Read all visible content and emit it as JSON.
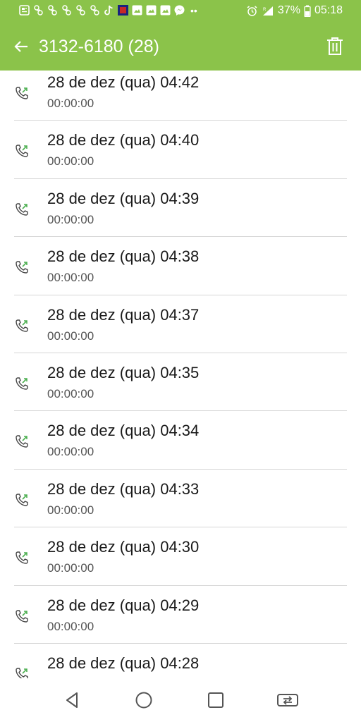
{
  "status_bar": {
    "battery": "37%",
    "time": "05:18",
    "overflow_dots": "••"
  },
  "app_bar": {
    "title": "3132-6180 (28)"
  },
  "calls": [
    {
      "date": "28 de dez (qua) 04:42",
      "duration": "00:00:00"
    },
    {
      "date": "28 de dez (qua) 04:40",
      "duration": "00:00:00"
    },
    {
      "date": "28 de dez (qua) 04:39",
      "duration": "00:00:00"
    },
    {
      "date": "28 de dez (qua) 04:38",
      "duration": "00:00:00"
    },
    {
      "date": "28 de dez (qua) 04:37",
      "duration": "00:00:00"
    },
    {
      "date": "28 de dez (qua) 04:35",
      "duration": "00:00:00"
    },
    {
      "date": "28 de dez (qua) 04:34",
      "duration": "00:00:00"
    },
    {
      "date": "28 de dez (qua) 04:33",
      "duration": "00:00:00"
    },
    {
      "date": "28 de dez (qua) 04:30",
      "duration": "00:00:00"
    },
    {
      "date": "28 de dez (qua) 04:29",
      "duration": "00:00:00"
    },
    {
      "date": "28 de dez (qua) 04:28",
      "duration": ""
    }
  ],
  "icons": {
    "call_type": "outgoing-call-icon",
    "back": "arrow-left-icon",
    "delete": "trash-icon"
  },
  "colors": {
    "accent": "#8bc34a",
    "call_icon_arrow": "#4caf50"
  }
}
